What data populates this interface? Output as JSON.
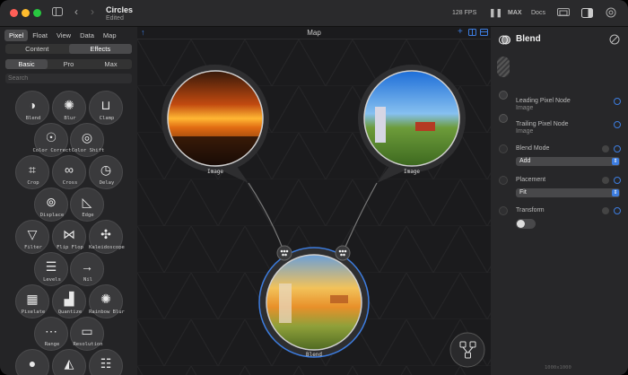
{
  "window": {
    "title": "Circles",
    "subtitle": "Edited",
    "fps": "128 FPS",
    "max_label": "MAX",
    "docs_label": "Docs"
  },
  "sidebar": {
    "menu_tabs": [
      "Pixel",
      "Float",
      "View",
      "Data",
      "Map"
    ],
    "mode_tabs": [
      "Content",
      "Effects"
    ],
    "level_tabs": [
      "Basic",
      "Pro",
      "Max"
    ],
    "search_placeholder": "Search",
    "nodes": [
      {
        "label": "Blend",
        "icon": "◑"
      },
      {
        "label": "Blur",
        "icon": "✺"
      },
      {
        "label": "Clamp",
        "icon": "⊔"
      },
      {
        "label": "Color Correct",
        "icon": "☉"
      },
      {
        "label": "Color Shift",
        "icon": "◎"
      },
      {
        "label": "Crop",
        "icon": "⌗"
      },
      {
        "label": "Cross",
        "icon": "∞"
      },
      {
        "label": "Delay",
        "icon": "◷"
      },
      {
        "label": "Displace",
        "icon": "⊚"
      },
      {
        "label": "Edge",
        "icon": "◺"
      },
      {
        "label": "Filter",
        "icon": "▽"
      },
      {
        "label": "Flip Flop",
        "icon": "⋈"
      },
      {
        "label": "Kaleidoscope",
        "icon": "✣"
      },
      {
        "label": "Levels",
        "icon": "☰"
      },
      {
        "label": "Nil",
        "icon": "→"
      },
      {
        "label": "Pixelate",
        "icon": "▦"
      },
      {
        "label": "Quantize",
        "icon": "▟"
      },
      {
        "label": "Rainbow Blur",
        "icon": "✺"
      },
      {
        "label": "Range",
        "icon": "⋯"
      },
      {
        "label": "Resolution",
        "icon": "▭"
      },
      {
        "label": "",
        "icon": "●"
      },
      {
        "label": "",
        "icon": "◭"
      },
      {
        "label": "",
        "icon": "☷"
      }
    ]
  },
  "canvas": {
    "header_label": "Map",
    "nodes": [
      {
        "label": "Image"
      },
      {
        "label": "Image"
      },
      {
        "label": "Blend"
      }
    ]
  },
  "inspector": {
    "title": "Blend",
    "properties": [
      {
        "label": "Leading Pixel Node",
        "sub": "Image"
      },
      {
        "label": "Trailing Pixel Node",
        "sub": "Image"
      },
      {
        "label": "Blend Mode",
        "value": "Add"
      },
      {
        "label": "Placement",
        "value": "Fit"
      },
      {
        "label": "Transform"
      }
    ],
    "footer": "1000x1000"
  },
  "colors": {
    "accent": "#3d7de0",
    "window_bg": "#1c1c1e",
    "sidebar_bg": "#242426",
    "inspector_bg": "#272729"
  }
}
